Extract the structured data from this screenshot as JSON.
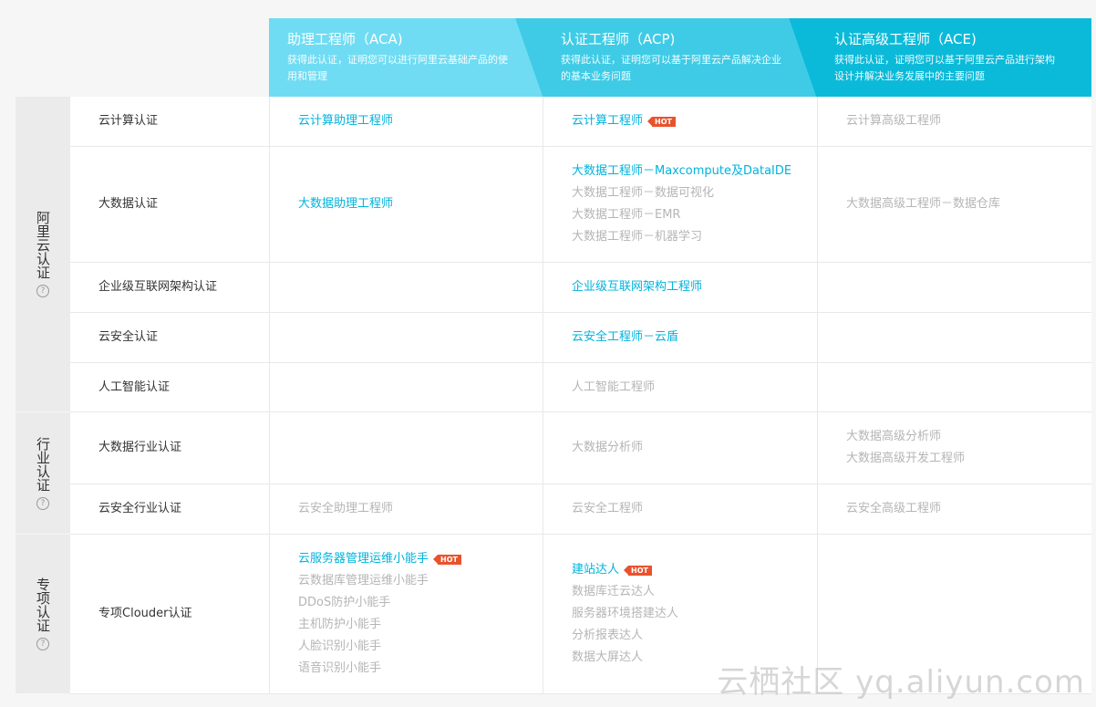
{
  "levels": [
    {
      "title": "助理工程师（ACA)",
      "desc": "获得此认证，证明您可以进行阿里云基础产品的使用和管理"
    },
    {
      "title": "认证工程师（ACP)",
      "desc": "获得此认证，证明您可以基于阿里云产品解决企业的基本业务问题"
    },
    {
      "title": "认证高级工程师（ACE)",
      "desc": "获得此认证，证明您可以基于阿里云产品进行架构设计并解决业务发展中的主要问题"
    }
  ],
  "groups": [
    {
      "label": "阿里云认证",
      "help_icon": "?"
    },
    {
      "label": "行业认证",
      "help_icon": "?"
    },
    {
      "label": "专项认证",
      "help_icon": "?"
    }
  ],
  "hot_label": "HOT",
  "rows": [
    {
      "name": "云计算认证",
      "aca": [
        {
          "text": "云计算助理工程师",
          "active": true
        }
      ],
      "acp": [
        {
          "text": "云计算工程师",
          "active": true,
          "hot": true
        }
      ],
      "ace": [
        {
          "text": "云计算高级工程师",
          "active": false
        }
      ]
    },
    {
      "name": "大数据认证",
      "aca": [
        {
          "text": "大数据助理工程师",
          "active": true
        }
      ],
      "acp": [
        {
          "text": "大数据工程师－Maxcompute及DataIDE",
          "active": true
        },
        {
          "text": "大数据工程师－数据可视化",
          "active": false
        },
        {
          "text": "大数据工程师－EMR",
          "active": false
        },
        {
          "text": "大数据工程师－机器学习",
          "active": false
        }
      ],
      "ace": [
        {
          "text": "大数据高级工程师－数据仓库",
          "active": false
        }
      ]
    },
    {
      "name": "企业级互联网架构认证",
      "aca": [],
      "acp": [
        {
          "text": "企业级互联网架构工程师",
          "active": true
        }
      ],
      "ace": []
    },
    {
      "name": "云安全认证",
      "aca": [],
      "acp": [
        {
          "text": "云安全工程师－云盾",
          "active": true
        }
      ],
      "ace": []
    },
    {
      "name": "人工智能认证",
      "aca": [],
      "acp": [
        {
          "text": "人工智能工程师",
          "active": false
        }
      ],
      "ace": []
    },
    {
      "name": "大数据行业认证",
      "aca": [],
      "acp": [
        {
          "text": "大数据分析师",
          "active": false
        }
      ],
      "ace": [
        {
          "text": "大数据高级分析师",
          "active": false
        },
        {
          "text": "大数据高级开发工程师",
          "active": false
        }
      ]
    },
    {
      "name": "云安全行业认证",
      "aca": [
        {
          "text": "云安全助理工程师",
          "active": false
        }
      ],
      "acp": [
        {
          "text": "云安全工程师",
          "active": false
        }
      ],
      "ace": [
        {
          "text": "云安全高级工程师",
          "active": false
        }
      ]
    },
    {
      "name": "专项Clouder认证",
      "aca": [
        {
          "text": "云服务器管理运维小能手",
          "active": true,
          "hot": true
        },
        {
          "text": "云数据库管理运维小能手",
          "active": false
        },
        {
          "text": "DDoS防护小能手",
          "active": false
        },
        {
          "text": "主机防护小能手",
          "active": false
        },
        {
          "text": "人脸识别小能手",
          "active": false
        },
        {
          "text": "语音识别小能手",
          "active": false
        }
      ],
      "acp": [
        {
          "text": "建站达人",
          "active": true,
          "hot": true
        },
        {
          "text": "数据库迁云达人",
          "active": false
        },
        {
          "text": "服务器环境搭建达人",
          "active": false
        },
        {
          "text": "分析报表达人",
          "active": false
        },
        {
          "text": "数据大屏达人",
          "active": false
        }
      ],
      "ace": []
    }
  ],
  "watermark": "云栖社区 yq.aliyun.com",
  "colors": {
    "link": "#00b3dd",
    "muted": "#b5b5b5",
    "hot": "#e8532d",
    "band_aca": "#6fdcf3",
    "band_acp": "#3fcbe6",
    "band_ace": "#0bbad9"
  }
}
